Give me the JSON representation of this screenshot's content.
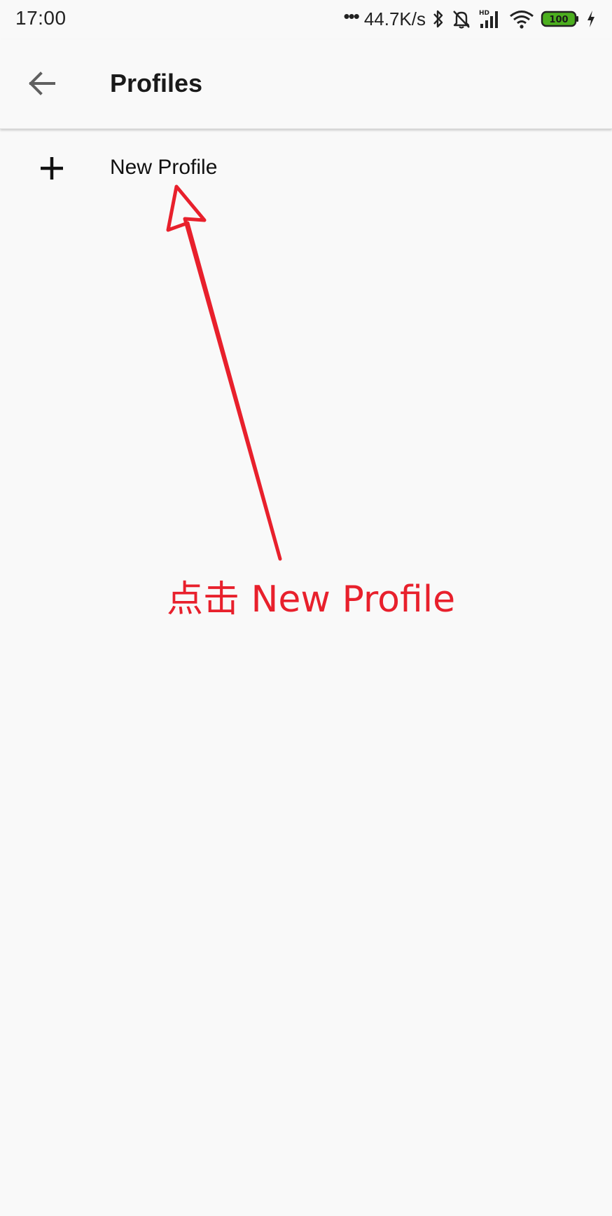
{
  "status_bar": {
    "time": "17:00",
    "net_speed": "44.7K/s",
    "signal_badge": "HD",
    "battery_level": "100",
    "icons": [
      "dots-icon",
      "bluetooth-icon",
      "bell-off-icon",
      "signal-icon",
      "wifi-icon",
      "battery-icon",
      "charging-icon"
    ],
    "battery_color": "#4caf1f"
  },
  "app_bar": {
    "title": "Profiles",
    "back_icon": "arrow-left-icon"
  },
  "list": {
    "items": [
      {
        "label": "New Profile",
        "icon": "plus-icon"
      }
    ]
  },
  "annotation": {
    "text": "点击 New Profile",
    "color": "#e8202c"
  }
}
